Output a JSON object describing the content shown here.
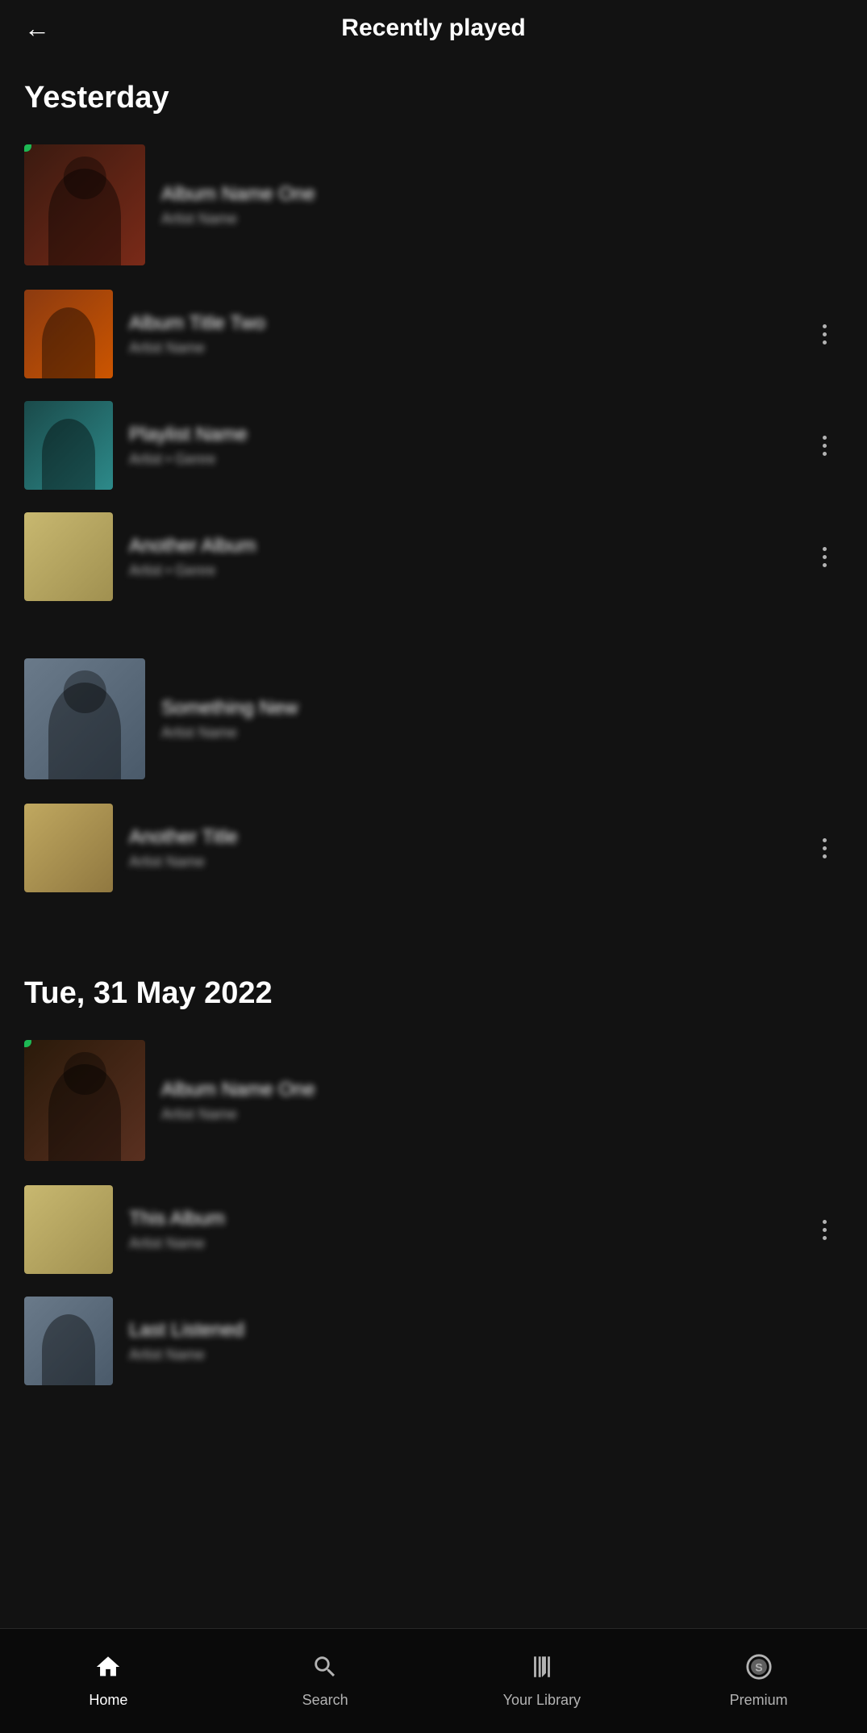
{
  "header": {
    "back_label": "←",
    "title": "Recently played"
  },
  "sections": [
    {
      "id": "yesterday",
      "title": "Yesterday",
      "items": [
        {
          "id": "item1",
          "name_blur": "Album Name One",
          "meta_blur": "Artist Name",
          "art_class": "art-dark-red",
          "has_dot": true,
          "has_more": false,
          "size": "large"
        },
        {
          "id": "item2",
          "name_blur": "Album Title Two",
          "meta_blur": "Artist Name",
          "art_class": "art-orange-dark",
          "has_dot": false,
          "has_more": true,
          "size": "normal"
        },
        {
          "id": "item3",
          "name_blur": "Playlist Name",
          "meta_blur": "Artist • Genre",
          "art_class": "art-teal",
          "has_dot": false,
          "has_more": true,
          "size": "normal"
        },
        {
          "id": "item4",
          "name_blur": "Another Album",
          "meta_blur": "Artist • Genre",
          "art_class": "art-sand",
          "has_dot": false,
          "has_more": true,
          "size": "normal"
        },
        {
          "id": "item5",
          "name_blur": "Something New",
          "meta_blur": "Artist Name",
          "art_class": "art-blue-gray",
          "has_dot": false,
          "has_more": false,
          "size": "large"
        },
        {
          "id": "item6",
          "name_blur": "Another Title",
          "meta_blur": "Artist Name",
          "art_class": "art-sand2",
          "has_dot": false,
          "has_more": true,
          "size": "normal"
        }
      ]
    },
    {
      "id": "may2022",
      "title": "Tue, 31 May 2022",
      "items": [
        {
          "id": "item7",
          "name_blur": "Album Name One",
          "meta_blur": "Artist Name",
          "art_class": "art-dark-portrait",
          "has_dot": true,
          "has_more": false,
          "size": "large"
        },
        {
          "id": "item8",
          "name_blur": "This Album",
          "meta_blur": "Artist Name",
          "art_class": "art-sand3",
          "has_dot": false,
          "has_more": true,
          "size": "normal"
        },
        {
          "id": "item9",
          "name_blur": "Last Listened",
          "meta_blur": "Artist Name",
          "art_class": "art-blue-gray",
          "has_dot": false,
          "has_more": false,
          "size": "normal"
        }
      ]
    }
  ],
  "nav": {
    "items": [
      {
        "id": "home",
        "label": "Home",
        "icon": "🏠",
        "active": true
      },
      {
        "id": "search",
        "label": "Search",
        "icon": "🔍",
        "active": false
      },
      {
        "id": "library",
        "label": "Your Library",
        "icon": "⏸",
        "active": false
      },
      {
        "id": "premium",
        "label": "Premium",
        "icon": "⭕",
        "active": false
      }
    ]
  }
}
